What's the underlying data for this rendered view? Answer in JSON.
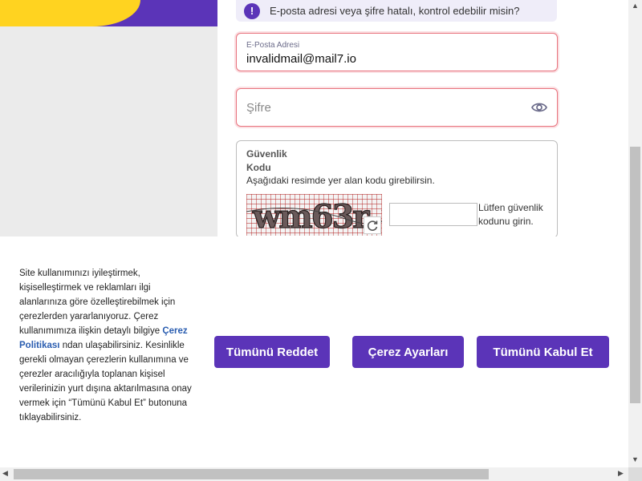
{
  "alert": {
    "icon": "exclamation-icon",
    "glyph": "!",
    "text": "E-posta adresi veya şifre hatalı, kontrol edebilir misin?"
  },
  "login": {
    "email_label": "E-Posta Adresi",
    "email_value": "invalidmail@mail7.io",
    "password_placeholder": "Şifre",
    "password_toggle_icon": "eye-icon"
  },
  "captcha": {
    "title_line1": "Güvenlik",
    "title_line2": "Kodu",
    "description": "Aşağıdaki resimde yer alan kodu girebilirsin.",
    "image_text": "wm63r",
    "refresh_icon": "refresh-icon",
    "input_value": "",
    "hint_line1": "Lütfen güvenlik",
    "hint_line2": "kodunu girin."
  },
  "cookie": {
    "text_before_link": "Site kullanımınızı iyileştirmek, kişiselleştirmek ve reklamları ilgi alanlarınıza göre özelleştirebilmek için çerezlerden yararlanıyoruz. Çerez kullanımımıza ilişkin detaylı bilgiye ",
    "link_text": "Çerez Politikası",
    "text_after_link": " ndan ulaşabilirsiniz. Kesinlikle gerekli olmayan çerezlerin kullanımına ve çerezler aracılığıyla toplanan kişisel verilerinizin yurt dışına aktarılmasına onay vermek için “Tümünü Kabul Et” butonuna tıklayabilirsiniz.",
    "reject_all": "Tümünü Reddet",
    "settings": "Çerez Ayarları",
    "accept_all": "Tümünü Kabul Et"
  },
  "colors": {
    "brand_purple": "#5b34b8",
    "accent_yellow": "#ffd320",
    "error_border": "#e8737e",
    "link_blue": "#2a5db0"
  }
}
